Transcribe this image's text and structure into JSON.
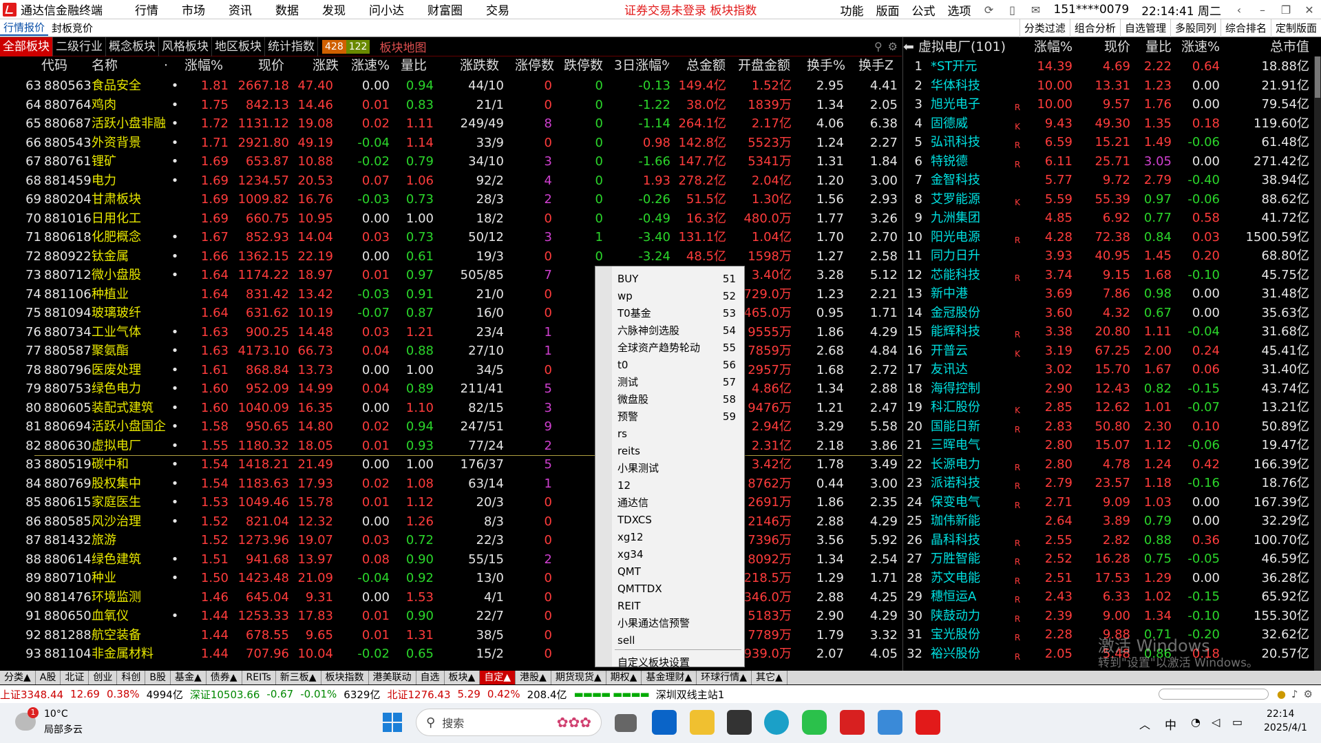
{
  "titlebar": {
    "app_title": "通达信金融终端",
    "menus": [
      "行情",
      "市场",
      "资讯",
      "数据",
      "发现",
      "问小达",
      "财富圈",
      "交易"
    ],
    "warning": "证券交易未登录  板块指数",
    "right": [
      "功能",
      "版面",
      "公式",
      "选项"
    ],
    "account": "151****0079",
    "clock": "22:14:41 周二"
  },
  "bar2": {
    "left": [
      "行情报价",
      "封板竞价"
    ],
    "right": [
      "分类过滤",
      "组合分析",
      "自选管理",
      "多股同列",
      "综合排名",
      "定制版面"
    ]
  },
  "category_tabs": [
    "全部板块",
    "二级行业",
    "概念板块",
    "风格板块",
    "地区板块",
    "统计指数"
  ],
  "up_count": "428",
  "down_count": "122",
  "map_label": "板块地图",
  "main_headers": [
    "代码",
    "名称",
    "·",
    "涨幅%",
    "现价",
    "涨跌",
    "涨速%",
    "量比",
    "涨跌数",
    "涨停数",
    "跌停数",
    "3日涨幅%",
    "总金额",
    "开盘金额",
    "换手%",
    "换手Z"
  ],
  "rows": [
    [
      "63",
      "880563",
      "食品安全",
      "•",
      "1.81",
      "2667.18",
      "47.40",
      "0.00",
      "0.94",
      "44/10",
      "0",
      "0",
      "-0.13",
      "149.4亿",
      "1.52亿",
      "2.95",
      "4.41"
    ],
    [
      "64",
      "880764",
      "鸡肉",
      "•",
      "1.75",
      "842.13",
      "14.46",
      "0.01",
      "0.83",
      "21/1",
      "0",
      "0",
      "-1.22",
      "38.0亿",
      "1839万",
      "1.34",
      "2.05"
    ],
    [
      "65",
      "880687",
      "活跃小盘非融",
      "•",
      "1.72",
      "1131.12",
      "19.08",
      "0.02",
      "1.11",
      "249/49",
      "8",
      "0",
      "-1.14",
      "264.1亿",
      "2.17亿",
      "4.06",
      "6.38"
    ],
    [
      "66",
      "880543",
      "外资背景",
      "•",
      "1.71",
      "2921.80",
      "49.19",
      "-0.04",
      "1.14",
      "33/9",
      "0",
      "0",
      "0.98",
      "142.8亿",
      "5523万",
      "1.24",
      "2.27"
    ],
    [
      "67",
      "880761",
      "锂矿",
      "•",
      "1.69",
      "653.87",
      "10.88",
      "-0.02",
      "0.79",
      "34/10",
      "3",
      "0",
      "-1.66",
      "147.7亿",
      "5341万",
      "1.31",
      "1.84"
    ],
    [
      "68",
      "881459",
      "电力",
      "•",
      "1.69",
      "1234.57",
      "20.53",
      "0.07",
      "1.06",
      "92/2",
      "4",
      "0",
      "1.93",
      "278.2亿",
      "2.04亿",
      "1.20",
      "3.00"
    ],
    [
      "69",
      "880204",
      "甘肃板块",
      "",
      "1.69",
      "1009.82",
      "16.76",
      "-0.03",
      "0.73",
      "28/3",
      "2",
      "0",
      "-0.26",
      "51.5亿",
      "1.30亿",
      "1.56",
      "2.93"
    ],
    [
      "70",
      "881016",
      "日用化工",
      "",
      "1.69",
      "660.75",
      "10.95",
      "0.00",
      "1.00",
      "18/2",
      "0",
      "0",
      "-0.49",
      "16.3亿",
      "480.0万",
      "1.77",
      "3.26"
    ],
    [
      "71",
      "880618",
      "化肥概念",
      "•",
      "1.67",
      "852.93",
      "14.04",
      "0.03",
      "0.73",
      "50/12",
      "3",
      "1",
      "-3.40",
      "131.1亿",
      "1.04亿",
      "1.70",
      "2.70"
    ],
    [
      "72",
      "880922",
      "钛金属",
      "•",
      "1.66",
      "1362.15",
      "22.19",
      "0.00",
      "0.61",
      "19/3",
      "0",
      "0",
      "-3.24",
      "48.5亿",
      "1598万",
      "1.27",
      "2.58"
    ],
    [
      "73",
      "880712",
      "微小盘股",
      "•",
      "1.64",
      "1174.22",
      "18.97",
      "0.01",
      "0.97",
      "505/85",
      "7",
      "0",
      "",
      "",
      "3.40亿",
      "3.28",
      "5.12"
    ],
    [
      "74",
      "881106",
      "种植业",
      "",
      "1.64",
      "831.42",
      "13.42",
      "-0.03",
      "0.91",
      "21/0",
      "0",
      "0",
      "",
      "",
      "729.0万",
      "1.23",
      "2.21"
    ],
    [
      "75",
      "881094",
      "玻璃玻纤",
      "",
      "1.64",
      "631.62",
      "10.19",
      "-0.07",
      "0.87",
      "16/0",
      "0",
      "0",
      "",
      "",
      "465.0万",
      "0.95",
      "1.71"
    ],
    [
      "76",
      "880734",
      "工业气体",
      "•",
      "1.63",
      "900.25",
      "14.48",
      "0.03",
      "1.21",
      "23/4",
      "1",
      "0",
      "",
      "",
      "9555万",
      "1.86",
      "4.29"
    ],
    [
      "77",
      "880587",
      "聚氨酯",
      "•",
      "1.63",
      "4173.10",
      "66.73",
      "0.04",
      "0.88",
      "27/10",
      "1",
      "0",
      "",
      "",
      "7859万",
      "2.68",
      "4.84"
    ],
    [
      "78",
      "880796",
      "医废处理",
      "•",
      "1.61",
      "868.84",
      "13.73",
      "0.00",
      "1.00",
      "34/5",
      "0",
      "0",
      "",
      "",
      "2957万",
      "1.68",
      "2.72"
    ],
    [
      "79",
      "880753",
      "绿色电力",
      "•",
      "1.60",
      "952.09",
      "14.99",
      "0.04",
      "0.89",
      "211/41",
      "5",
      "0",
      "",
      "",
      "4.86亿",
      "1.34",
      "2.88"
    ],
    [
      "80",
      "880605",
      "装配式建筑",
      "•",
      "1.60",
      "1040.09",
      "16.35",
      "0.00",
      "1.10",
      "82/15",
      "3",
      "0",
      "",
      "",
      "9476万",
      "1.21",
      "2.47"
    ],
    [
      "81",
      "880694",
      "活跃小盘国企",
      "•",
      "1.58",
      "950.65",
      "14.80",
      "0.02",
      "0.94",
      "247/51",
      "9",
      "0",
      "",
      "",
      "2.94亿",
      "3.29",
      "5.58"
    ],
    [
      "82",
      "880630",
      "虚拟电厂",
      "•",
      "1.55",
      "1180.32",
      "18.05",
      "0.01",
      "0.93",
      "77/24",
      "2",
      "0",
      "",
      "",
      "2.31亿",
      "2.18",
      "3.86"
    ],
    [
      "83",
      "880519",
      "碳中和",
      "•",
      "1.54",
      "1418.21",
      "21.49",
      "0.00",
      "1.00",
      "176/37",
      "5",
      "0",
      "",
      "",
      "3.42亿",
      "1.78",
      "3.49"
    ],
    [
      "84",
      "880769",
      "股权集中",
      "•",
      "1.54",
      "1183.63",
      "17.93",
      "0.02",
      "1.08",
      "63/14",
      "1",
      "0",
      "",
      "",
      "8762万",
      "0.44",
      "3.00"
    ],
    [
      "85",
      "880615",
      "家庭医生",
      "•",
      "1.53",
      "1049.46",
      "15.78",
      "0.01",
      "1.12",
      "20/3",
      "0",
      "0",
      "",
      "",
      "2691万",
      "1.86",
      "2.35"
    ],
    [
      "86",
      "880585",
      "风沙治理",
      "•",
      "1.52",
      "821.04",
      "12.32",
      "0.00",
      "1.26",
      "8/3",
      "0",
      "0",
      "",
      "",
      "2146万",
      "2.88",
      "4.29"
    ],
    [
      "87",
      "881432",
      "旅游",
      "",
      "1.52",
      "1273.96",
      "19.07",
      "0.03",
      "0.72",
      "22/3",
      "0",
      "0",
      "",
      "",
      "7396万",
      "3.56",
      "5.92"
    ],
    [
      "88",
      "880614",
      "绿色建筑",
      "•",
      "1.51",
      "941.68",
      "13.97",
      "0.08",
      "0.90",
      "55/15",
      "2",
      "0",
      "",
      "",
      "8092万",
      "1.34",
      "2.54"
    ],
    [
      "89",
      "880710",
      "种业",
      "•",
      "1.50",
      "1423.48",
      "21.09",
      "-0.04",
      "0.92",
      "13/0",
      "0",
      "0",
      "",
      "",
      "218.5万",
      "1.29",
      "1.71"
    ],
    [
      "90",
      "881476",
      "环境监测",
      "",
      "1.46",
      "645.04",
      "9.31",
      "0.00",
      "1.53",
      "4/1",
      "0",
      "0",
      "",
      "",
      "346.0万",
      "2.88",
      "4.25"
    ],
    [
      "91",
      "880650",
      "血氧仪",
      "•",
      "1.44",
      "1253.33",
      "17.83",
      "0.01",
      "0.90",
      "22/7",
      "0",
      "0",
      "",
      "",
      "5183万",
      "2.90",
      "4.29"
    ],
    [
      "92",
      "881288",
      "航空装备",
      "",
      "1.44",
      "678.55",
      "9.65",
      "0.01",
      "1.31",
      "38/5",
      "0",
      "0",
      "",
      "",
      "7789万",
      "1.79",
      "3.32"
    ],
    [
      "93",
      "881104",
      "非金属材料",
      "",
      "1.44",
      "707.96",
      "10.04",
      "-0.02",
      "0.65",
      "15/2",
      "0",
      "0",
      "",
      "",
      "939.0万",
      "2.07",
      "4.05"
    ]
  ],
  "right_panel": {
    "title": "虚拟电厂(101)",
    "headers": [
      "涨幅%",
      "现价",
      "量比",
      "涨速%",
      "总市值"
    ],
    "rows": [
      [
        "1",
        "*ST开元",
        "",
        "14.39",
        "4.69",
        "2.22",
        "0.64",
        "18.88亿"
      ],
      [
        "2",
        "华体科技",
        "",
        "10.00",
        "13.31",
        "1.23",
        "0.00",
        "21.91亿"
      ],
      [
        "3",
        "旭光电子",
        "R",
        "10.00",
        "9.57",
        "1.76",
        "0.00",
        "79.54亿"
      ],
      [
        "4",
        "固德威",
        "K",
        "9.43",
        "49.30",
        "1.35",
        "0.18",
        "119.60亿"
      ],
      [
        "5",
        "弘讯科技",
        "R",
        "6.59",
        "15.21",
        "1.49",
        "-0.06",
        "61.48亿"
      ],
      [
        "6",
        "特锐德",
        "R",
        "6.11",
        "25.71",
        "3.05",
        "0.00",
        "271.42亿"
      ],
      [
        "7",
        "金智科技",
        "",
        "5.77",
        "9.72",
        "2.79",
        "-0.40",
        "38.94亿"
      ],
      [
        "8",
        "艾罗能源",
        "K",
        "5.59",
        "55.39",
        "0.97",
        "-0.06",
        "88.62亿"
      ],
      [
        "9",
        "九洲集团",
        "",
        "4.85",
        "6.92",
        "0.77",
        "0.58",
        "41.72亿"
      ],
      [
        "10",
        "阳光电源",
        "R",
        "4.28",
        "72.38",
        "0.84",
        "0.03",
        "1500.59亿"
      ],
      [
        "11",
        "同力日升",
        "",
        "3.93",
        "40.95",
        "1.45",
        "0.20",
        "68.80亿"
      ],
      [
        "12",
        "芯能科技",
        "R",
        "3.74",
        "9.15",
        "1.68",
        "-0.10",
        "45.75亿"
      ],
      [
        "13",
        "新中港",
        "",
        "3.69",
        "7.86",
        "0.98",
        "0.00",
        "31.48亿"
      ],
      [
        "14",
        "金冠股份",
        "",
        "3.60",
        "4.32",
        "0.67",
        "0.00",
        "35.63亿"
      ],
      [
        "15",
        "能辉科技",
        "R",
        "3.38",
        "20.80",
        "1.11",
        "-0.04",
        "31.68亿"
      ],
      [
        "16",
        "开普云",
        "K",
        "3.19",
        "67.25",
        "2.00",
        "0.24",
        "45.41亿"
      ],
      [
        "17",
        "友讯达",
        "",
        "3.02",
        "15.70",
        "1.67",
        "0.06",
        "31.40亿"
      ],
      [
        "18",
        "海得控制",
        "",
        "2.90",
        "12.43",
        "0.82",
        "-0.15",
        "43.74亿"
      ],
      [
        "19",
        "科汇股份",
        "K",
        "2.85",
        "12.62",
        "1.01",
        "-0.07",
        "13.21亿"
      ],
      [
        "20",
        "国能日新",
        "R",
        "2.83",
        "50.80",
        "2.30",
        "0.10",
        "50.89亿"
      ],
      [
        "21",
        "三晖电气",
        "",
        "2.80",
        "15.07",
        "1.12",
        "-0.06",
        "19.47亿"
      ],
      [
        "22",
        "长源电力",
        "R",
        "2.80",
        "4.78",
        "1.24",
        "0.42",
        "166.39亿"
      ],
      [
        "23",
        "派诺科技",
        "R",
        "2.79",
        "23.57",
        "1.18",
        "-0.16",
        "18.76亿"
      ],
      [
        "24",
        "保变电气",
        "R",
        "2.71",
        "9.09",
        "1.03",
        "0.00",
        "167.39亿"
      ],
      [
        "25",
        "珈伟新能",
        "",
        "2.64",
        "3.89",
        "0.79",
        "0.00",
        "32.29亿"
      ],
      [
        "26",
        "晶科科技",
        "R",
        "2.55",
        "2.82",
        "0.88",
        "0.36",
        "100.70亿"
      ],
      [
        "27",
        "万胜智能",
        "R",
        "2.52",
        "16.28",
        "0.75",
        "-0.05",
        "46.59亿"
      ],
      [
        "28",
        "苏文电能",
        "R",
        "2.51",
        "17.53",
        "1.29",
        "0.00",
        "36.28亿"
      ],
      [
        "29",
        "穗恒运A",
        "R",
        "2.43",
        "6.33",
        "1.02",
        "-0.15",
        "65.92亿"
      ],
      [
        "30",
        "陕鼓动力",
        "R",
        "2.39",
        "9.00",
        "1.34",
        "-0.10",
        "155.30亿"
      ],
      [
        "31",
        "宝光股份",
        "R",
        "2.28",
        "9.88",
        "0.71",
        "-0.20",
        "32.62亿"
      ],
      [
        "32",
        "裕兴股份",
        "R",
        "2.05",
        "5.48",
        "0.86",
        "0.18",
        "20.57亿"
      ]
    ]
  },
  "context_menu": [
    [
      "BUY",
      "51"
    ],
    [
      "wp",
      "52"
    ],
    [
      "T0基金",
      "53"
    ],
    [
      "六脉神剑选股",
      "54"
    ],
    [
      "全球资产趋势轮动",
      "55"
    ],
    [
      "t0",
      "56"
    ],
    [
      "测试",
      "57"
    ],
    [
      "微盘股",
      "58"
    ],
    [
      "预警",
      "59"
    ],
    [
      "rs",
      ""
    ],
    [
      "reits",
      ""
    ],
    [
      "小果测试",
      ""
    ],
    [
      "12",
      ""
    ],
    [
      "通达信",
      ""
    ],
    [
      "TDXCS",
      ""
    ],
    [
      "xg12",
      ""
    ],
    [
      "xg34",
      ""
    ],
    [
      "QMT",
      ""
    ],
    [
      "QMTTDX",
      ""
    ],
    [
      "REIT",
      ""
    ],
    [
      "小果通达信预警",
      ""
    ],
    [
      "sell",
      ""
    ],
    [
      "自定义板块设置",
      ""
    ]
  ],
  "bottom_tabs": [
    "分类▲",
    "A股",
    "北证",
    "创业",
    "科创",
    "B股",
    "基金▲",
    "债券▲",
    "REITs",
    "新三板▲",
    "板块指数",
    "港美联动",
    "自选",
    "板块▲",
    "自定▲",
    "港股▲",
    "期货现货▲",
    "期权▲",
    "基金理财▲",
    "环球行情▲",
    "其它▲"
  ],
  "bottom_active": "自定▲",
  "status": {
    "sh_label": "上证3348.44",
    "sh_chg": "12.69",
    "sh_pct": "0.38%",
    "sh_amt": "4994亿",
    "sz_label": "深证10503.66",
    "sz_chg": "-0.67",
    "sz_pct": "-0.01%",
    "sz_amt": "6329亿",
    "bz_label": "北证1276.43",
    "bz_chg": "5.29",
    "bz_pct": "0.42%",
    "bz_amt": "208.4亿",
    "server": "深圳双线主站1"
  },
  "watermark": {
    "line1": "激活 Windows",
    "line2": "转到\"设置\"以激活 Windows。"
  },
  "taskbar": {
    "weather_temp": "10°C",
    "weather_desc": "局部多云",
    "weather_badge": "1",
    "search_placeholder": "搜索",
    "ime": "中",
    "time": "22:14",
    "date": "2025/4/1"
  }
}
